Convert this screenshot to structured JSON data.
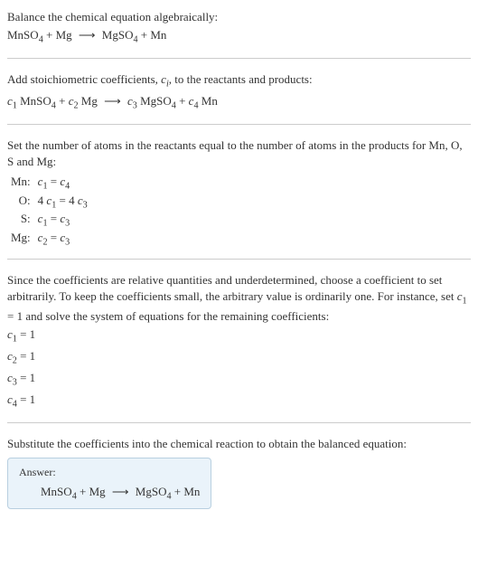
{
  "s1": {
    "title": "Balance the chemical equation algebraically:",
    "eq_html": "MnSO<span class='subn'>4</span> + Mg <span class='arrow'>⟶</span> MgSO<span class='subn'>4</span> + Mn"
  },
  "s2": {
    "text_html": "Add stoichiometric coefficients, <span class='it'>c<span class='sub'>i</span></span>, to the reactants and products:",
    "eq_html": "<span class='it'>c</span><span class='subn'>1</span> MnSO<span class='subn'>4</span> + <span class='it'>c</span><span class='subn'>2</span> Mg <span class='arrow'>⟶</span> <span class='it'>c</span><span class='subn'>3</span> MgSO<span class='subn'>4</span> + <span class='it'>c</span><span class='subn'>4</span> Mn"
  },
  "s3": {
    "text": "Set the number of atoms in the reactants equal to the number of atoms in the products for Mn, O, S and Mg:",
    "rows": [
      {
        "el": "Mn:",
        "eq_html": "<span class='it'>c</span><span class='subn'>1</span> = <span class='it'>c</span><span class='subn'>4</span>"
      },
      {
        "el": "O:",
        "eq_html": "4 <span class='it'>c</span><span class='subn'>1</span> = 4 <span class='it'>c</span><span class='subn'>3</span>"
      },
      {
        "el": "S:",
        "eq_html": "<span class='it'>c</span><span class='subn'>1</span> = <span class='it'>c</span><span class='subn'>3</span>"
      },
      {
        "el": "Mg:",
        "eq_html": "<span class='it'>c</span><span class='subn'>2</span> = <span class='it'>c</span><span class='subn'>3</span>"
      }
    ]
  },
  "s4": {
    "text_html": "Since the coefficients are relative quantities and underdetermined, choose a coefficient to set arbitrarily. To keep the coefficients small, the arbitrary value is ordinarily one. For instance, set <span class='it'>c</span><span class='subn'>1</span> = 1 and solve the system of equations for the remaining coefficients:",
    "vals": [
      "<span class='it'>c</span><span class='subn'>1</span> = 1",
      "<span class='it'>c</span><span class='subn'>2</span> = 1",
      "<span class='it'>c</span><span class='subn'>3</span> = 1",
      "<span class='it'>c</span><span class='subn'>4</span> = 1"
    ]
  },
  "s5": {
    "text": "Substitute the coefficients into the chemical reaction to obtain the balanced equation:",
    "answer_label": "Answer:",
    "answer_eq_html": "MnSO<span class='subn'>4</span> + Mg <span class='arrow'>⟶</span> MgSO<span class='subn'>4</span> + Mn"
  },
  "chart_data": {
    "type": "table",
    "reaction_unbalanced": "MnSO4 + Mg -> MgSO4 + Mn",
    "stoichiometric_form": "c1 MnSO4 + c2 Mg -> c3 MgSO4 + c4 Mn",
    "atom_balance": [
      {
        "element": "Mn",
        "equation": "c1 = c4"
      },
      {
        "element": "O",
        "equation": "4 c1 = 4 c3"
      },
      {
        "element": "S",
        "equation": "c1 = c3"
      },
      {
        "element": "Mg",
        "equation": "c2 = c3"
      }
    ],
    "solution": {
      "c1": 1,
      "c2": 1,
      "c3": 1,
      "c4": 1
    },
    "balanced_equation": "MnSO4 + Mg -> MgSO4 + Mn"
  }
}
